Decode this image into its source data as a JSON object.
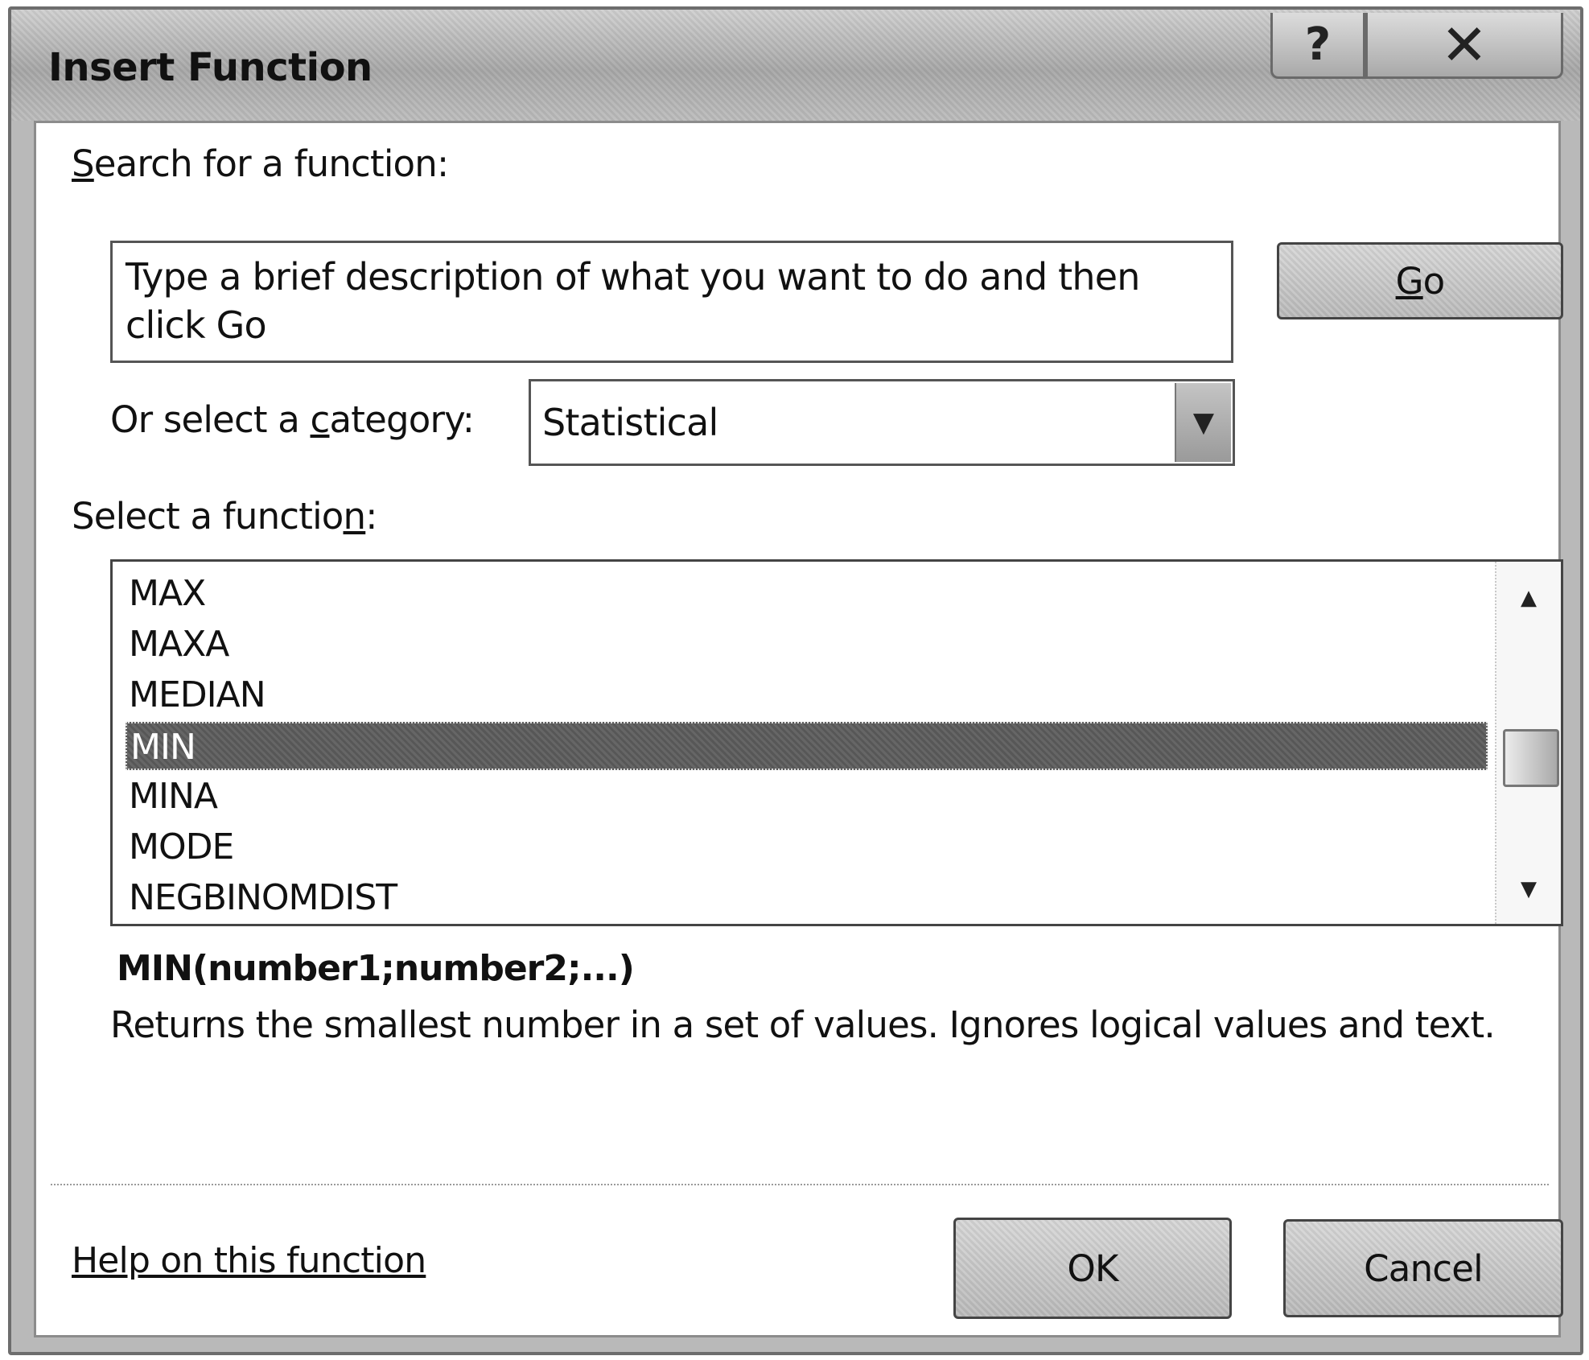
{
  "window": {
    "title": "Insert Function",
    "help_glyph": "?",
    "close_glyph": "✕"
  },
  "search": {
    "label_prefix": "",
    "label_key": "S",
    "label_rest": "earch for a function:",
    "input_value": "Type a brief description of what you want to do and then click Go",
    "go_button_key": "G",
    "go_button_rest": "o"
  },
  "category": {
    "label_pre": "Or select a ",
    "label_key": "c",
    "label_post": "ategory:",
    "selected": "Statistical",
    "arrow_glyph": "▼"
  },
  "functions": {
    "label_pre": "Select a functio",
    "label_key": "n",
    "label_post": ":",
    "items": [
      "MAX",
      "MAXA",
      "MEDIAN",
      "MIN",
      "MINA",
      "MODE",
      "NEGBINOMDIST"
    ],
    "selected_index": 3,
    "scroll_up_glyph": "▲",
    "scroll_down_glyph": "▼"
  },
  "details": {
    "signature": "MIN(number1;number2;...)",
    "description": "Returns the smallest number in a set of values. Ignores logical values and text."
  },
  "footer": {
    "help_link": "Help on this function",
    "ok_label": "OK",
    "cancel_label": "Cancel"
  },
  "colors": {
    "selection_bg": "#5e5e5e",
    "frame": "#b9b9b9"
  }
}
